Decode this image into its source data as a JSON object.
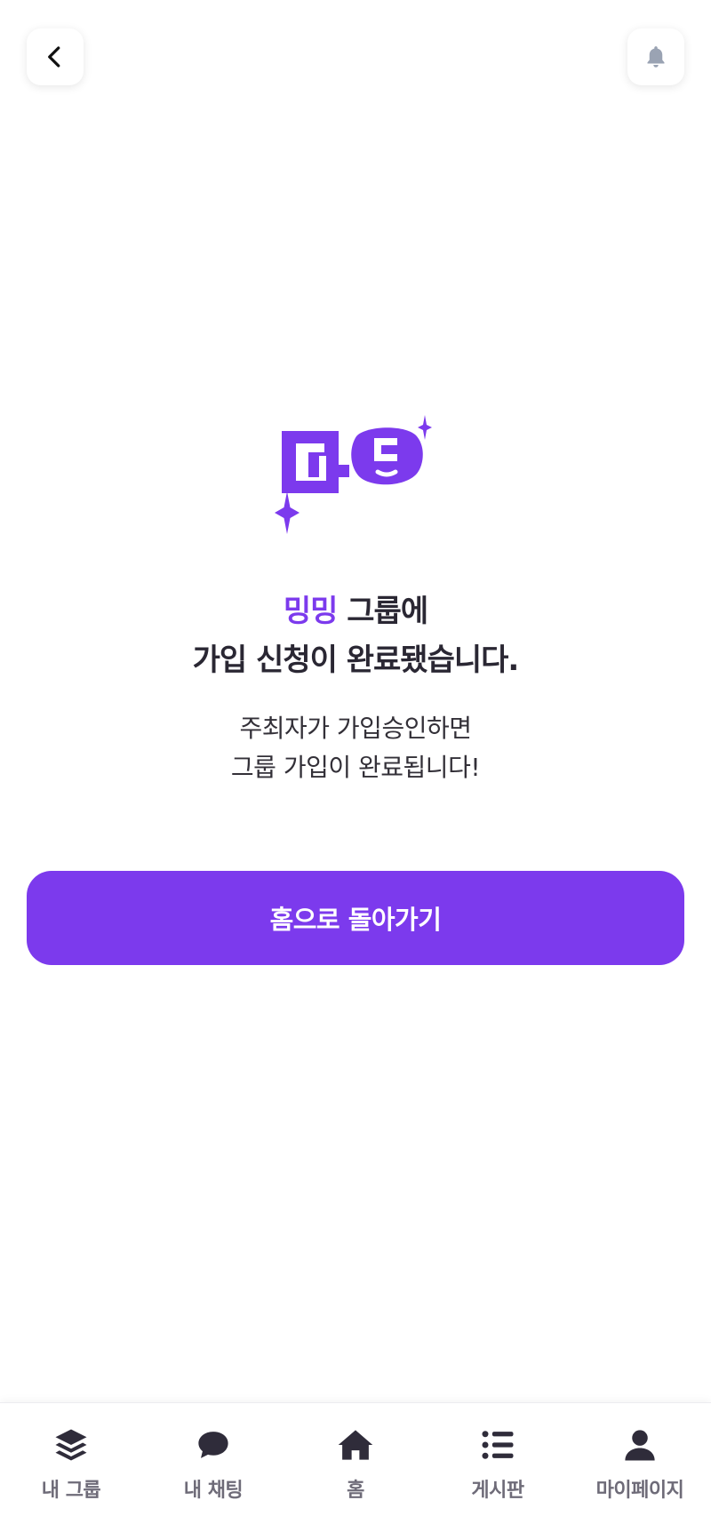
{
  "header": {
    "back_icon": "chevron-left-icon",
    "notification_icon": "bell-icon"
  },
  "logo": {
    "name": "mingming-logo",
    "color": "#7c3aed"
  },
  "headline": {
    "group_name": "밍밍",
    "line1_suffix": " 그룹에",
    "line2": "가입 신청이 완료됐습니다."
  },
  "subtext": {
    "line1": "주최자가 가입승인하면",
    "line2": "그룹 가입이 완료됩니다!"
  },
  "cta": {
    "label": "홈으로 돌아가기"
  },
  "tabbar": {
    "items": [
      {
        "label": "내 그룹",
        "icon": "layers-icon"
      },
      {
        "label": "내 채팅",
        "icon": "chat-bubble-icon"
      },
      {
        "label": "홈",
        "icon": "home-icon"
      },
      {
        "label": "게시판",
        "icon": "list-icon"
      },
      {
        "label": "마이페이지",
        "icon": "user-icon"
      }
    ]
  },
  "colors": {
    "accent": "#7c3aed",
    "text": "#2a2733",
    "tab_icon": "#2f2c3a",
    "tab_label": "#6e6b78",
    "bell": "#9aa3b3"
  }
}
